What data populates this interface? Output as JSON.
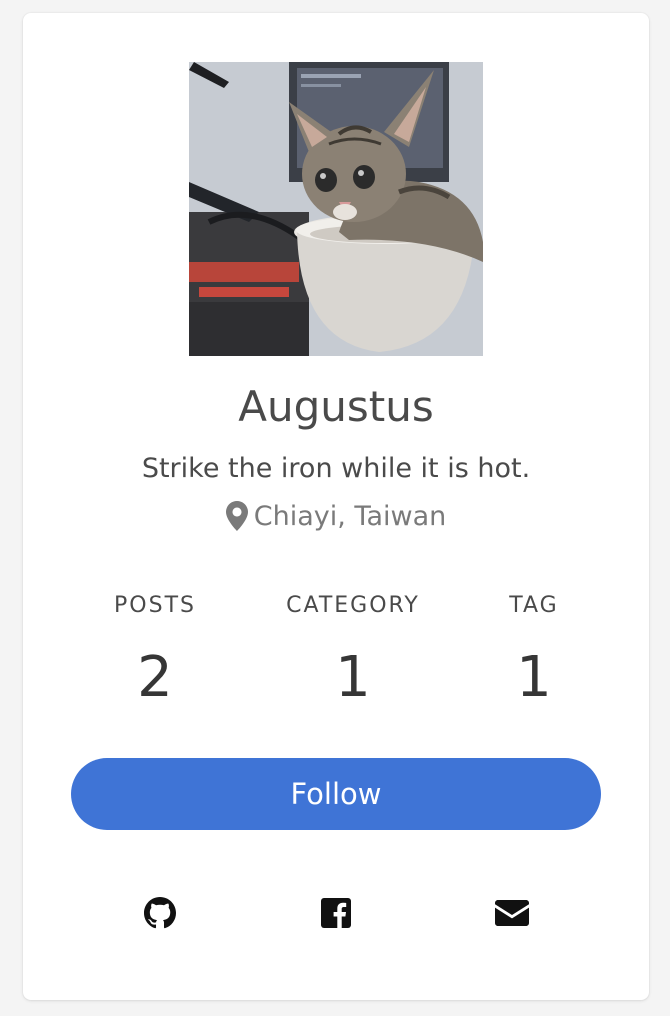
{
  "profile": {
    "name": "Augustus",
    "motto": "Strike the iron while it is hot.",
    "location": "Chiayi, Taiwan",
    "avatar_alt": "kitten sitting in a white bowl"
  },
  "stats": [
    {
      "label": "POSTS",
      "value": "2"
    },
    {
      "label": "CATEGORY",
      "value": "1"
    },
    {
      "label": "TAG",
      "value": "1"
    }
  ],
  "follow_button": {
    "label": "Follow",
    "color": "#3f74d6"
  },
  "social_links": [
    {
      "icon": "github-icon"
    },
    {
      "icon": "facebook-icon"
    },
    {
      "icon": "email-icon"
    }
  ],
  "colors": {
    "background": "#f4f4f4",
    "card": "#ffffff",
    "text": "#4a4a4a",
    "muted": "#7a7a7a"
  }
}
